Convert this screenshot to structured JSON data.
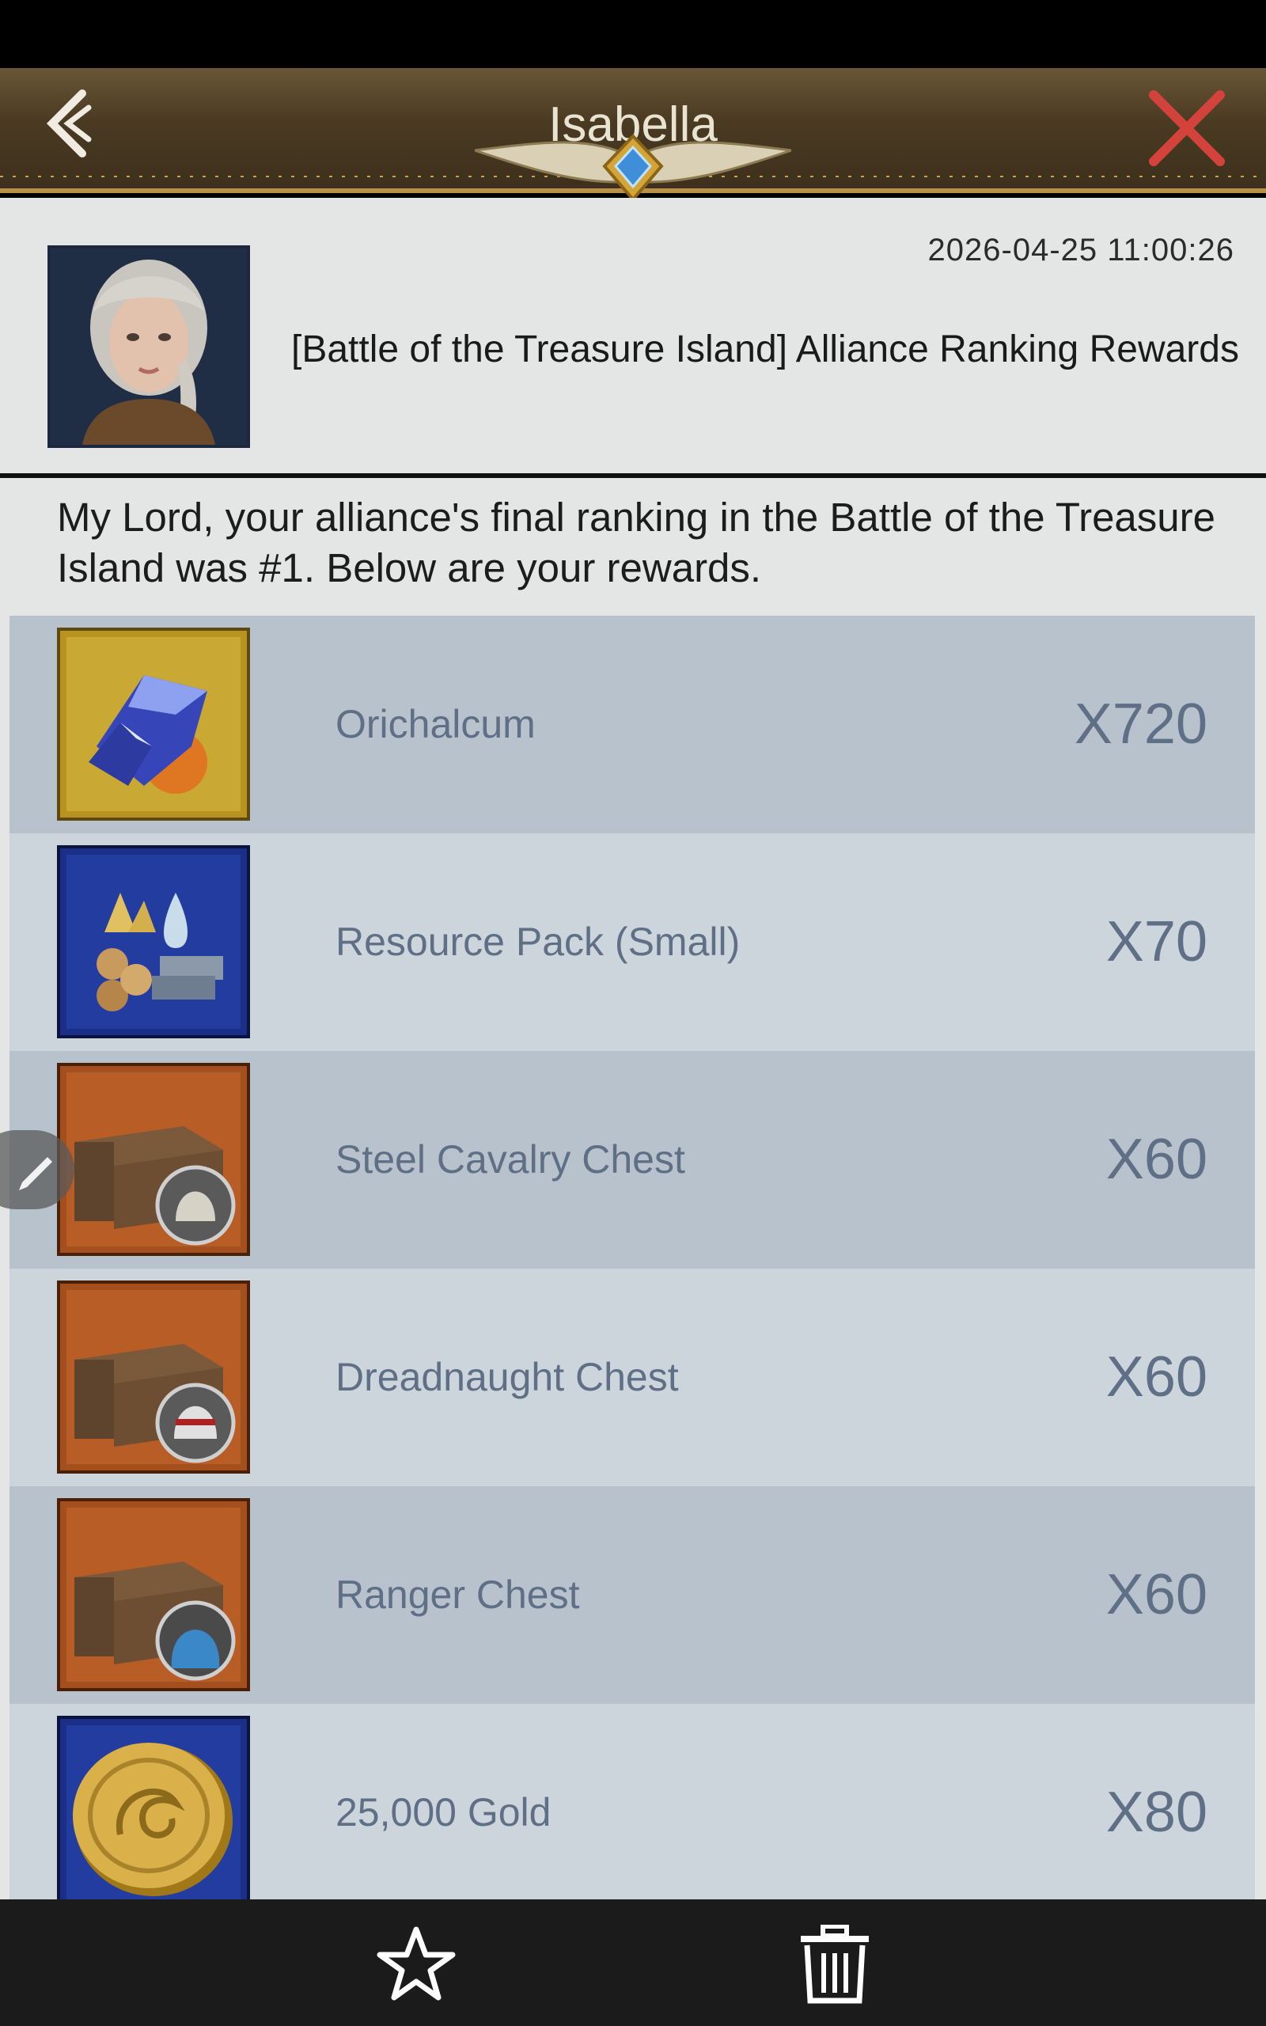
{
  "header": {
    "title": "Isabella",
    "back_icon": "back-arrow-icon",
    "close_icon": "close-x-icon",
    "accent_color": "#d4433b"
  },
  "mail": {
    "timestamp": "2026-04-25  11:00:26",
    "subject": "[Battle of the Treasure Island] Alliance Ranking Rewards",
    "body": "My Lord, your alliance's final ranking in the Battle of the Treasure Island was #1. Below are your rewards."
  },
  "rewards": [
    {
      "name": "Orichalcum",
      "qty": "X720",
      "icon": "orichalcum-icon"
    },
    {
      "name": "Resource Pack (Small)",
      "qty": "X70",
      "icon": "resource-pack-icon"
    },
    {
      "name": "Steel Cavalry Chest",
      "qty": "X60",
      "icon": "cavalry-chest-icon"
    },
    {
      "name": "Dreadnaught Chest",
      "qty": "X60",
      "icon": "dreadnaught-chest-icon"
    },
    {
      "name": "Ranger Chest",
      "qty": "X60",
      "icon": "ranger-chest-icon"
    },
    {
      "name": "25,000 Gold",
      "qty": "X80",
      "icon": "gold-coin-icon"
    }
  ],
  "toolbar": {
    "favorite_icon": "star-icon",
    "delete_icon": "trash-icon",
    "edit_icon": "pencil-icon"
  }
}
